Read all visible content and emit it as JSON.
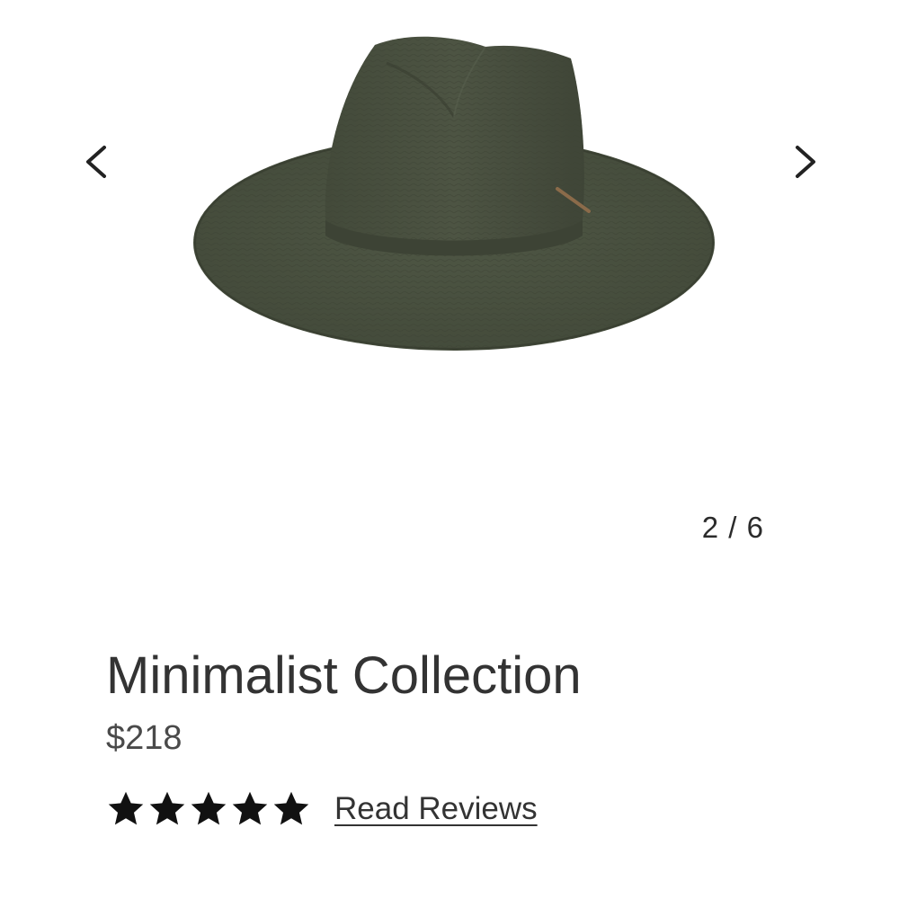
{
  "gallery": {
    "current_index": 2,
    "total": 6,
    "pager_text": "2 / 6",
    "image_subject": "olive green wide-brim woven straw fedora hat",
    "prev_icon": "chevron-left-icon",
    "next_icon": "chevron-right-icon"
  },
  "product": {
    "title": "Minimalist Collection",
    "price": "$218",
    "rating": 5,
    "rating_max": 5,
    "reviews_link": "Read Reviews"
  },
  "colors": {
    "hat": "#4a5140",
    "text": "#333333",
    "star": "#111111",
    "background": "#ffffff"
  }
}
